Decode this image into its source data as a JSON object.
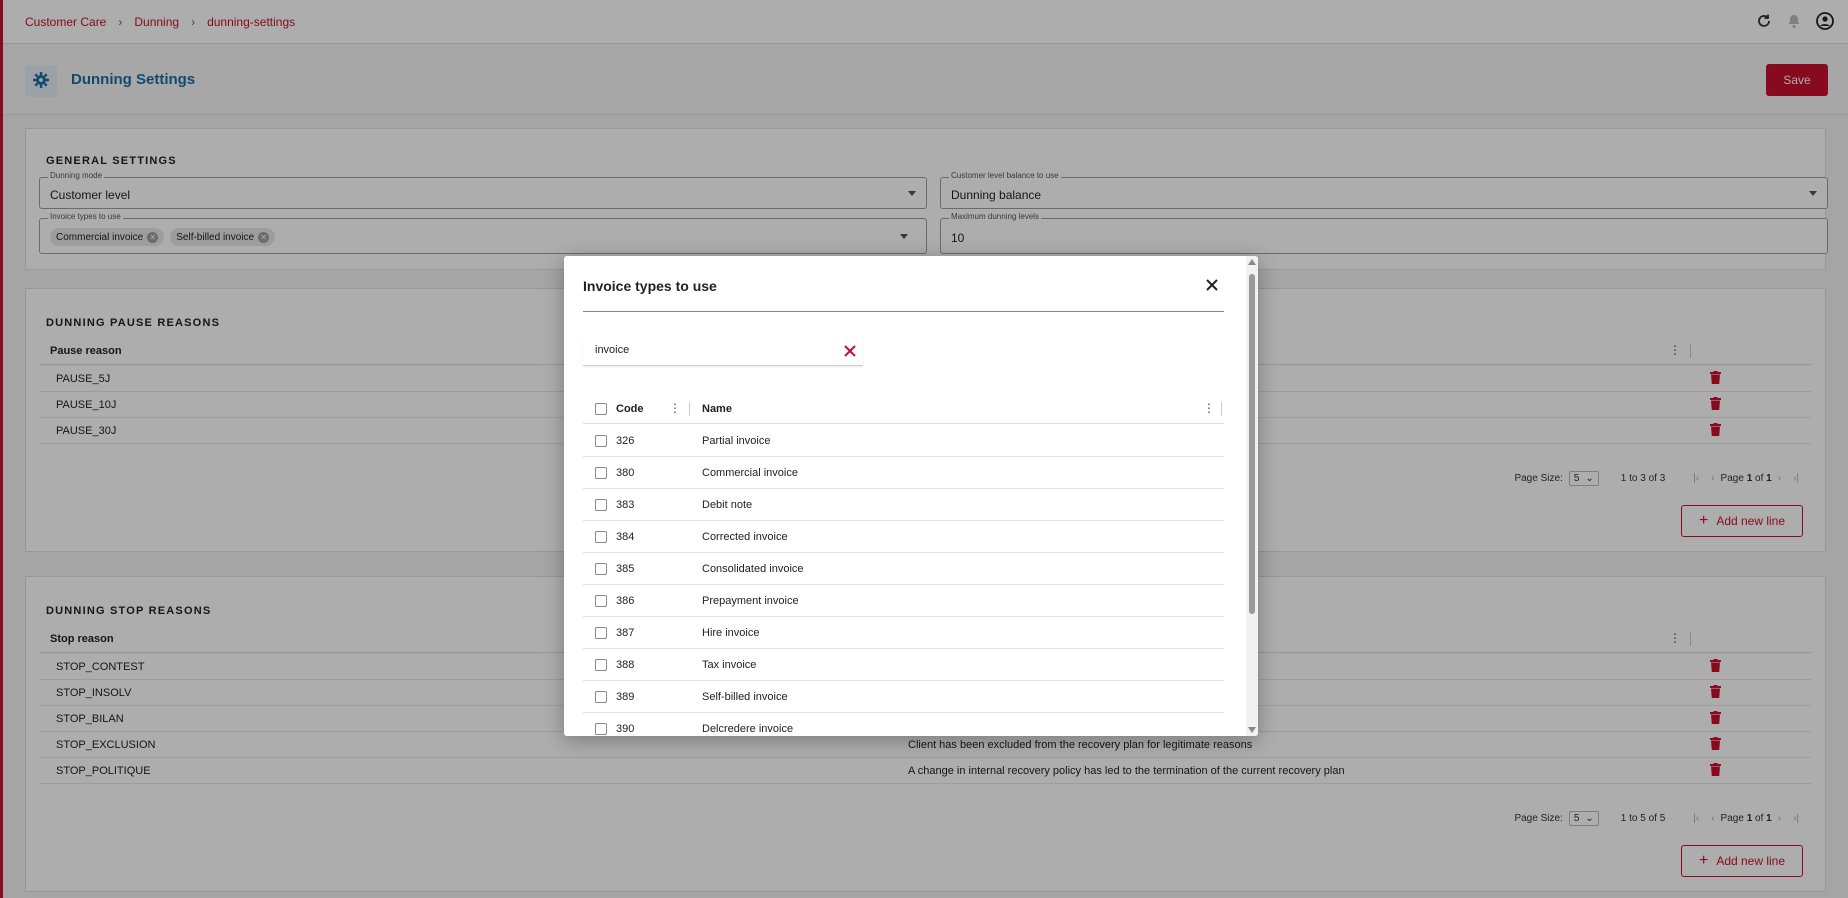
{
  "breadcrumb": [
    "Customer Care",
    "Dunning",
    "dunning-settings"
  ],
  "header": {
    "title": "Dunning Settings",
    "save_label": "Save"
  },
  "general": {
    "title": "GENERAL SETTINGS",
    "dunning_mode": {
      "label": "Dunning mode",
      "value": "Customer level"
    },
    "balance": {
      "label": "Customer level balance to use",
      "value": "Dunning balance"
    },
    "invoice_types": {
      "label": "Invoice types to use",
      "chips": [
        "Commercial invoice",
        "Self-billed invoice"
      ]
    },
    "max_levels": {
      "label": "Maximum dunning levels",
      "value": "10"
    }
  },
  "pause": {
    "title": "DUNNING PAUSE REASONS",
    "column": "Pause reason",
    "rows": [
      "PAUSE_5J",
      "PAUSE_10J",
      "PAUSE_30J"
    ],
    "pager": {
      "page_size_label": "Page Size:",
      "page_size": "5",
      "count": "1 to 3 of 3",
      "page_word": "Page",
      "page": "1",
      "of_word": "of",
      "total": "1"
    },
    "add_label": "Add new line"
  },
  "stop": {
    "title": "DUNNING STOP REASONS",
    "column": "Stop reason",
    "rows": [
      {
        "code": "STOP_CONTEST",
        "desc": ""
      },
      {
        "code": "STOP_INSOLV",
        "desc": ""
      },
      {
        "code": "STOP_BILAN",
        "desc": ""
      },
      {
        "code": "STOP_EXCLUSION",
        "desc": "Client has been excluded from the recovery plan for legitimate reasons"
      },
      {
        "code": "STOP_POLITIQUE",
        "desc": "A change in internal recovery policy has led to the termination of the current recovery plan"
      }
    ],
    "pager": {
      "page_size_label": "Page Size:",
      "page_size": "5",
      "count": "1 to 5 of 5",
      "page_word": "Page",
      "page": "1",
      "of_word": "of",
      "total": "1"
    },
    "add_label": "Add new line"
  },
  "modal": {
    "title": "Invoice types to use",
    "search_value": "invoice",
    "col_code": "Code",
    "col_name": "Name",
    "rows": [
      {
        "code": "326",
        "name": "Partial invoice"
      },
      {
        "code": "380",
        "name": "Commercial invoice"
      },
      {
        "code": "383",
        "name": "Debit note"
      },
      {
        "code": "384",
        "name": "Corrected invoice"
      },
      {
        "code": "385",
        "name": "Consolidated invoice"
      },
      {
        "code": "386",
        "name": "Prepayment invoice"
      },
      {
        "code": "387",
        "name": "Hire invoice"
      },
      {
        "code": "388",
        "name": "Tax invoice"
      },
      {
        "code": "389",
        "name": "Self-billed invoice"
      },
      {
        "code": "390",
        "name": "Delcredere invoice"
      }
    ]
  },
  "colors": {
    "accent": "#c8102e",
    "title_blue": "#1a6fa0"
  }
}
